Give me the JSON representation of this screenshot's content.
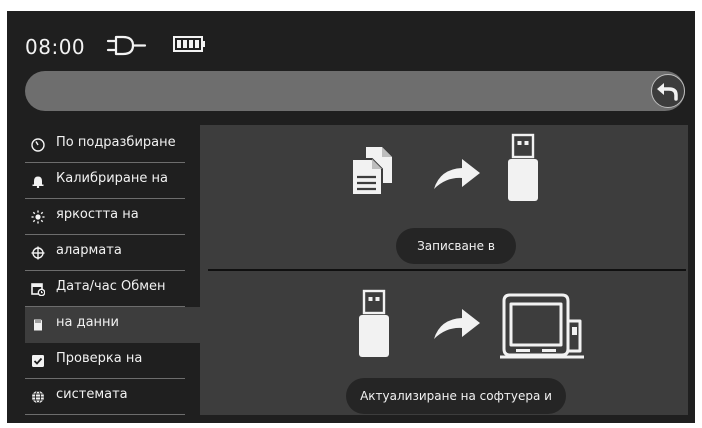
{
  "status": {
    "time": "08:00",
    "icons": [
      "plug-icon",
      "battery-icon"
    ]
  },
  "search": {
    "value": ""
  },
  "sidebar": {
    "items": [
      {
        "label": "По подразбиране",
        "icon": "gauge-icon"
      },
      {
        "label": "Калибриране на",
        "icon": "bell-icon"
      },
      {
        "label": "яркостта на",
        "icon": "brightness-icon"
      },
      {
        "label": "алармата",
        "icon": "crosshair-icon"
      },
      {
        "label": "Дата/час Обмен",
        "icon": "calendar-clock-icon"
      },
      {
        "label": "на данни",
        "icon": "sd-card-icon",
        "active": true
      },
      {
        "label": "Проверка на",
        "icon": "checkbox-icon"
      },
      {
        "label": "системата",
        "icon": "globe-icon"
      }
    ]
  },
  "panel": {
    "export_button": "Записване в",
    "update_button": "Актуализиране на софтуера и"
  },
  "colors": {
    "background": "#1f1f1f",
    "panel": "#3d3d3d",
    "search_bar": "#6e6e6e",
    "button": "#252525",
    "text": "#f2f2f2"
  }
}
